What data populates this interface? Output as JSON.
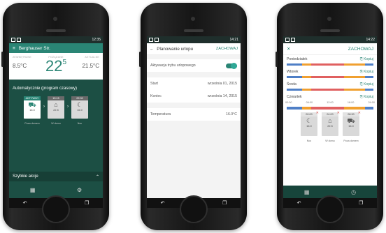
{
  "status": {
    "time1": "12:35",
    "time2": "14:21",
    "time3": "14:22"
  },
  "screen1": {
    "title": "Berghauser Str.",
    "labels": {
      "ustawiona": "ZEWNĘTRZNE",
      "pozadana": "POŻĄDANE",
      "aktualna": "AKTUALNE"
    },
    "outside": "8.5°C",
    "desired_int": "22",
    "desired_frac": "5",
    "current": "21.5°C",
    "mode": "Automatycznie (program czasowy)",
    "blocks": [
      {
        "time": "AKTYWNY",
        "value": "16.0",
        "label": "Poza domem"
      },
      {
        "time": "15:15",
        "value": "22.5",
        "label": "W domu"
      },
      {
        "time": "22:00",
        "value": "16.0",
        "label": "Noc"
      }
    ],
    "quick": "Szybkie akcje"
  },
  "screen2": {
    "title": "Planowanie urlopu",
    "save": "ZACHOWAJ",
    "toggle_label": "Aktywacja trybu urlopowego",
    "start_label": "Start",
    "start_value": "września 01, 2015",
    "end_label": "Koniec",
    "end_value": "września 14, 2015",
    "temp_label": "Temperatura",
    "temp_value": "16.0°C"
  },
  "screen3": {
    "save": "ZACHOWAJ",
    "copy": "Kopiuj",
    "days": [
      "Poniedziałek",
      "Wtorek",
      "Środa",
      "Czwartek"
    ],
    "axis": [
      "00:00",
      "06:00",
      "12:00",
      "18:00",
      "24:00"
    ],
    "blocks": [
      {
        "time": "00:00",
        "value": "16.0",
        "label": "Noc"
      },
      {
        "time": "04:00",
        "value": "22.5",
        "label": "W domu"
      },
      {
        "time": "08:30",
        "value": "16.0",
        "label": "Poza domem"
      }
    ]
  },
  "colors": {
    "accent": "#2a8575",
    "dark": "#1c4f44",
    "blue": "#4f7fc6",
    "orange": "#f0a030",
    "red": "#e06060"
  }
}
